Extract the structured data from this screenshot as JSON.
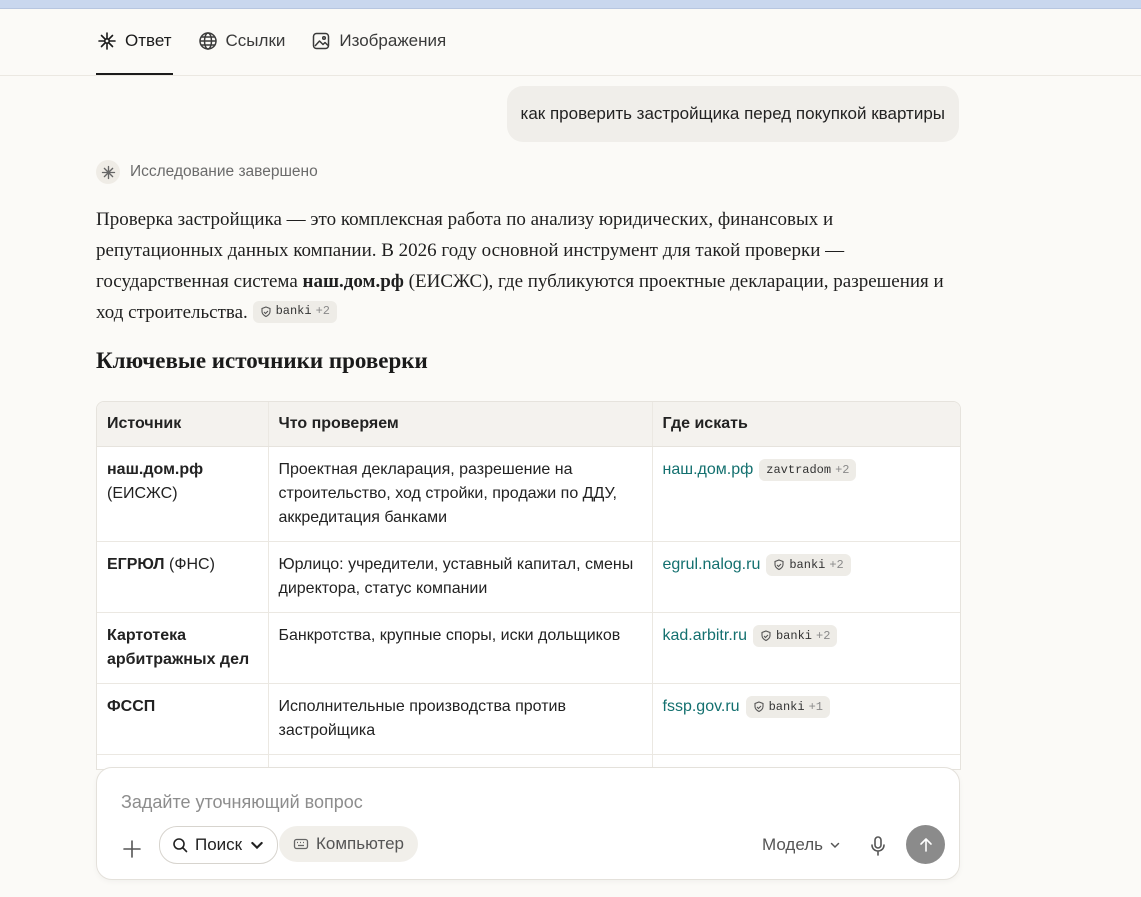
{
  "tabs": [
    {
      "label": "Ответ",
      "icon": "spark-icon",
      "active": true
    },
    {
      "label": "Ссылки",
      "icon": "globe-icon",
      "active": false
    },
    {
      "label": "Изображения",
      "icon": "image-icon",
      "active": false
    }
  ],
  "user_message": "как проверить застройщика перед покупкой квартиры",
  "status_text": "Исследование завершено",
  "answer": {
    "part1": "Проверка застройщика — это комплексная работа по анализу юридических, финансовых и репутационных данных компании. В 2026 году основной инструмент для такой проверки — государственная система ",
    "bold": "наш.дом.рф",
    "part2": " (ЕИСЖС), где публикуются проектные декларации, разрешения и ход строительства.",
    "source": {
      "name": "banki",
      "count": "+2"
    }
  },
  "section_heading": "Ключевые источники проверки",
  "table": {
    "headers": [
      "Источник",
      "Что проверяем",
      "Где искать"
    ],
    "rows": [
      {
        "source_bold": "наш.дом.рф",
        "source_rest": "(ЕИСЖС)",
        "what": "Проектная декларация, разрешение на строительство, ход стройки, продажи по ДДУ, аккредитация банками",
        "link": "наш.дом.рф",
        "chip": "zavtradom",
        "chip_count": "+2"
      },
      {
        "source_bold": "ЕГРЮЛ",
        "source_rest": "(ФНС)",
        "what": "Юрлицо: учредители, уставный капитал, смены директора, статус компании",
        "link": "egrul.nalog.ru",
        "chip": "banki",
        "chip_count": "+2"
      },
      {
        "source_bold": "Картотека арбитражных дел",
        "source_rest": "",
        "what": "Банкротства, крупные споры, иски дольщиков",
        "link": "kad.arbitr.ru",
        "chip": "banki",
        "chip_count": "+2"
      },
      {
        "source_bold": "ФССП",
        "source_rest": "",
        "what": "Исполнительные производства против застройщика",
        "link": "fssp.gov.ru",
        "chip": "banki",
        "chip_count": "+1"
      }
    ]
  },
  "composer": {
    "placeholder": "Задайте уточняющий вопрос",
    "search_label": "Поиск",
    "computer_label": "Компьютер",
    "model_label": "Модель"
  }
}
